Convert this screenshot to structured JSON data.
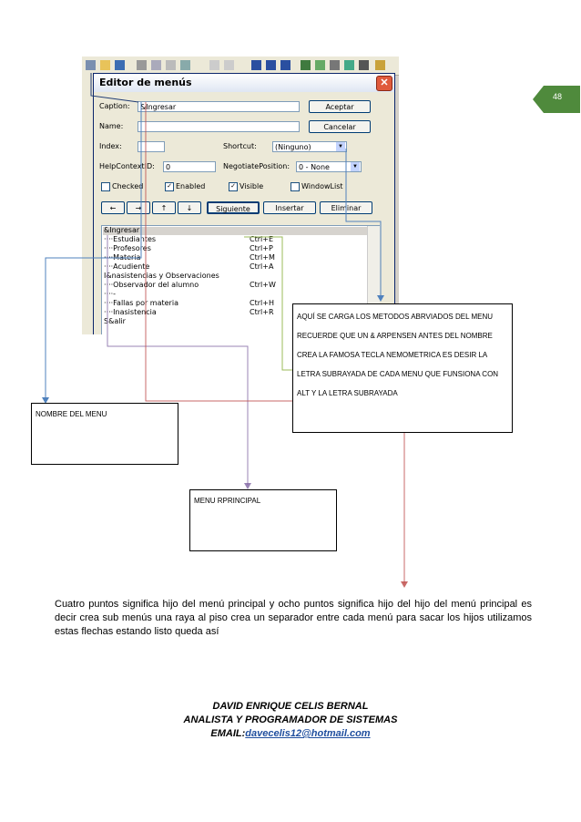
{
  "page_number": "48",
  "dialog": {
    "title": "Editor de menús",
    "caption_label": "Caption:",
    "caption_value": "&Ingresar",
    "name_label": "Name:",
    "name_value": "",
    "index_label": "Index:",
    "shortcut_label": "Shortcut:",
    "shortcut_value": "(Ninguno)",
    "helpcontext_label": "HelpContextID:",
    "helpcontext_value": "0",
    "negotiate_label": "NegotiatePosition:",
    "negotiate_value": "0 - None",
    "checked_label": "Checked",
    "enabled_label": "Enabled",
    "visible_label": "Visible",
    "windowlist_label": "WindowList",
    "aceptar": "Aceptar",
    "cancelar": "Cancelar",
    "siguiente": "Siguiente",
    "insertar": "Insertar",
    "eliminar": "Eliminar",
    "arrows": [
      "←",
      "→",
      "↑",
      "↓"
    ],
    "menu_items": [
      {
        "text": "&Ingresar",
        "shortcut": ""
      },
      {
        "text": "····Estudiantes",
        "shortcut": "Ctrl+E"
      },
      {
        "text": "····Profesores",
        "shortcut": "Ctrl+P"
      },
      {
        "text": "····Materia",
        "shortcut": "Ctrl+M"
      },
      {
        "text": "····Acudiente",
        "shortcut": "Ctrl+A"
      },
      {
        "text": "I&nasistencias y Observaciones",
        "shortcut": ""
      },
      {
        "text": "····Observador del alumno",
        "shortcut": "Ctrl+W"
      },
      {
        "text": "····-",
        "shortcut": ""
      },
      {
        "text": "····Fallas por materia",
        "shortcut": "Ctrl+H"
      },
      {
        "text": "····Inasistencia",
        "shortcut": "Ctrl+R"
      },
      {
        "text": "S&alir",
        "shortcut": ""
      }
    ]
  },
  "callouts": {
    "nombre": "NOMBRE DEL MENU",
    "menu_principal": "MENU RPRINCIPAL",
    "aqui": "AQUÍ SE CARGA LOS METODOS ABRVIADOS DEL MENU RECUERDE QUE UN & ARPENSEN ANTES DEL NOMBRE CREA LA FAMOSA TECLA NEMOMETRICA ES DESIR LA LETRA SUBRAYADA DE CADA MENU QUE FUNSIONA CON ALT Y LA LETRA SUBRAYADA"
  },
  "paragraph": "Cuatro puntos significa hijo del menú principal y ocho puntos significa hijo del hijo del menú principal es decir crea sub menús una raya al piso crea un separador entre cada menú para sacar los hijos utilizamos estas flechas estando listo queda así",
  "footer": {
    "name": "DAVID ENRIQUE CELIS BERNAL",
    "role": "ANALISTA Y PROGRAMADOR DE SISTEMAS",
    "email_label": "EMAIL:",
    "email": "davecelis12@hotmail.com"
  },
  "colors": {
    "badge": "#4f8a3c",
    "line_blue": "#4f81bd",
    "line_red": "#c0504d",
    "line_green": "#9bbb59",
    "line_purple": "#8064a2"
  }
}
